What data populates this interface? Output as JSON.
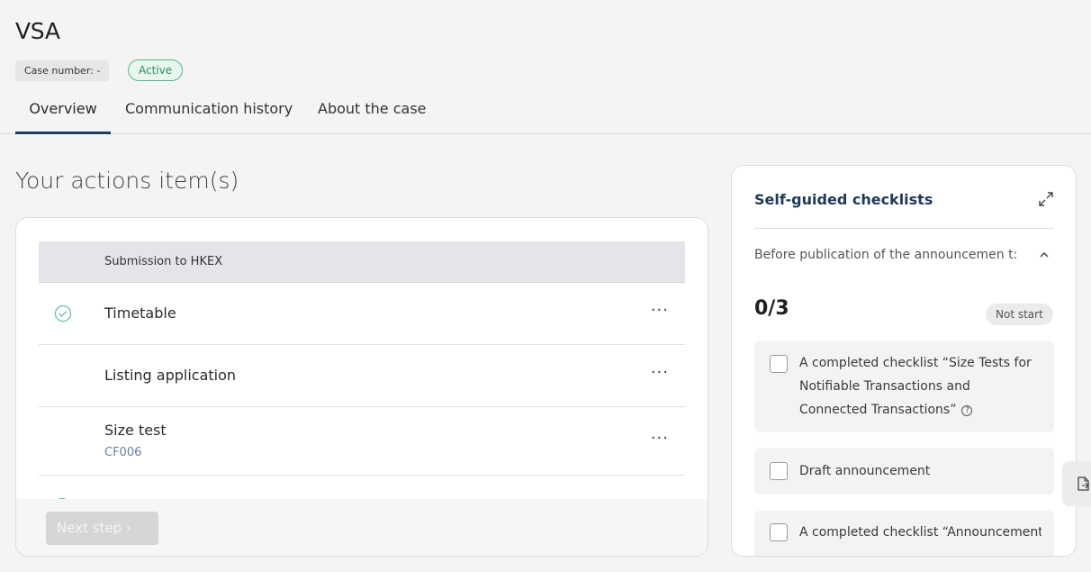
{
  "header": {
    "title": "VSA",
    "case_number": "Case number: -",
    "status": "Active",
    "tabs": [
      {
        "label": "Overview"
      },
      {
        "label": "Communication history"
      },
      {
        "label": "About the case"
      }
    ]
  },
  "actions": {
    "section_title": "Your actions item(s)",
    "group_header": "Submission to HKEX",
    "rows": [
      {
        "label": "Timetable",
        "sub": "",
        "done": true,
        "menu": "···"
      },
      {
        "label": "Listing application",
        "sub": "",
        "done": false,
        "menu": "···"
      },
      {
        "label": "Size test",
        "sub": "CF006",
        "done": false,
        "menu": "···"
      }
    ],
    "next_button": "Next step ›"
  },
  "checklists": {
    "title": "Self-guided checklists",
    "section_label": "Before publication of the announcemen t:",
    "progress": "0/3",
    "status": "Not start",
    "items": [
      {
        "text": "A completed checklist “Size Tests for Notifiable Transactions and Connected Transactions”",
        "help": "?"
      },
      {
        "text": "Draft announcement"
      },
      {
        "text": "A completed checklist “Announcement"
      }
    ]
  },
  "colors": {
    "accent": "#1d3e5e",
    "success": "#4fb483",
    "link": "#6a7fb0"
  },
  "icons": [
    "check-circle-icon",
    "more-horizontal-icon",
    "expand-icon",
    "chevron-up-icon",
    "help-circle-icon",
    "export-file-icon"
  ]
}
